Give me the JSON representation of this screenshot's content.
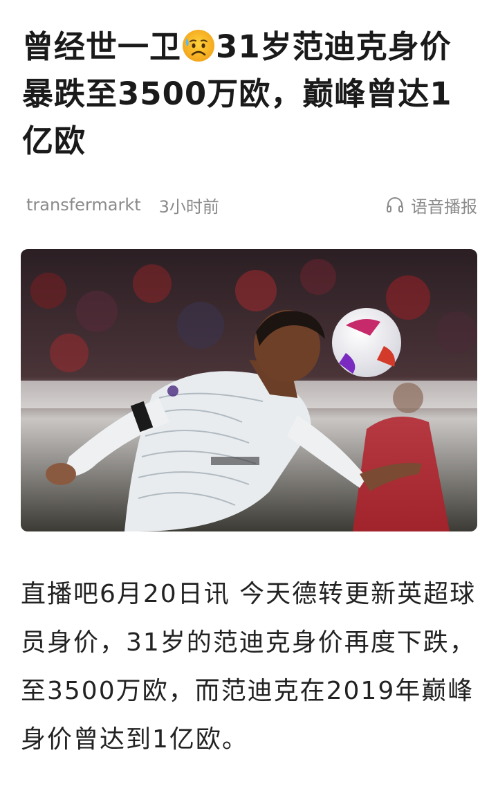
{
  "article": {
    "title_part1": "曾经世一卫",
    "title_emoji": "sad-sweat-emoji",
    "title_part2": "31岁范迪克身价暴跌至3500万欧，巅峰曾达1亿欧",
    "source": "transfermarkt",
    "time": "3小时前",
    "audio_label": "语音播报",
    "body": "直播吧6月20日讯 今天德转更新英超球员身价，31岁的范迪克身价再度下跌，至3500万欧，而范迪克在2019年巅峰身价曾达到1亿欧。"
  },
  "photo": {
    "description_icon": "football-player-header-photo",
    "colors": {
      "background": "#3a2a2c",
      "kit": "#e8ecef",
      "accent_red": "#c4202b"
    }
  },
  "colors": {
    "title": "#1a1a1a",
    "meta": "#8a8a8a",
    "body": "#222222"
  }
}
